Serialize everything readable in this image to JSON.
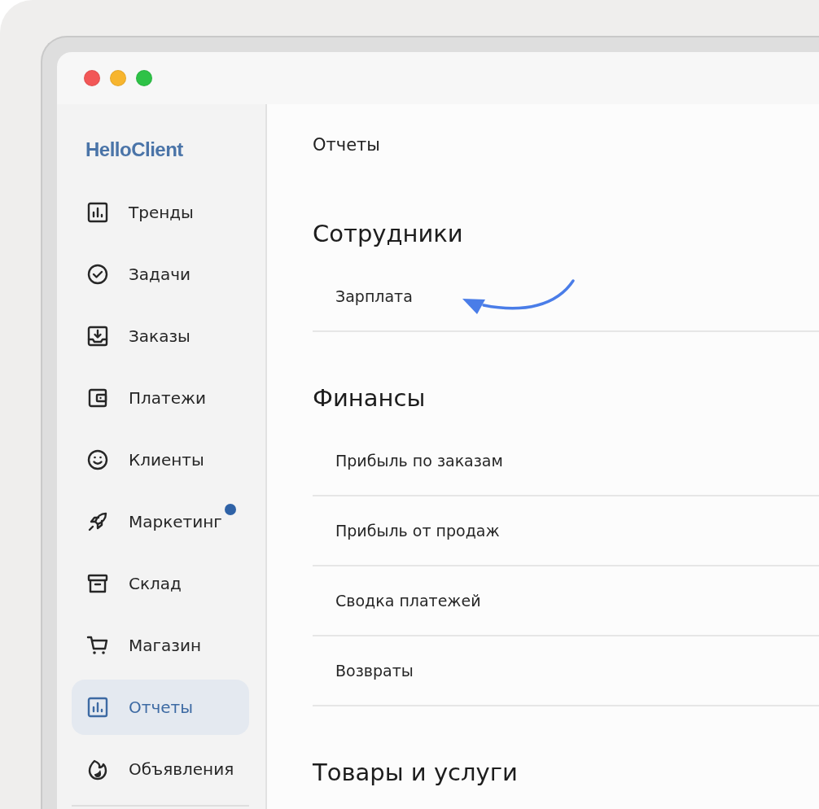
{
  "sidebar": {
    "logo": "HelloClient",
    "items": [
      {
        "label": "Тренды",
        "selected": false,
        "notification": false
      },
      {
        "label": "Задачи",
        "selected": false,
        "notification": false
      },
      {
        "label": "Заказы",
        "selected": false,
        "notification": false
      },
      {
        "label": "Платежи",
        "selected": false,
        "notification": false
      },
      {
        "label": "Клиенты",
        "selected": false,
        "notification": false
      },
      {
        "label": "Маркетинг",
        "selected": false,
        "notification": true
      },
      {
        "label": "Склад",
        "selected": false,
        "notification": false
      },
      {
        "label": "Магазин",
        "selected": false,
        "notification": false
      },
      {
        "label": "Отчеты",
        "selected": true,
        "notification": false
      },
      {
        "label": "Объявления",
        "selected": false,
        "notification": false
      }
    ]
  },
  "page": {
    "title": "Отчеты",
    "sections": [
      {
        "heading": "Сотрудники",
        "items": [
          "Зарплата"
        ]
      },
      {
        "heading": "Финансы",
        "items": [
          "Прибыль по заказам",
          "Прибыль от продаж",
          "Сводка платежей",
          "Возвраты"
        ]
      },
      {
        "heading": "Товары и услуги"
      }
    ]
  }
}
